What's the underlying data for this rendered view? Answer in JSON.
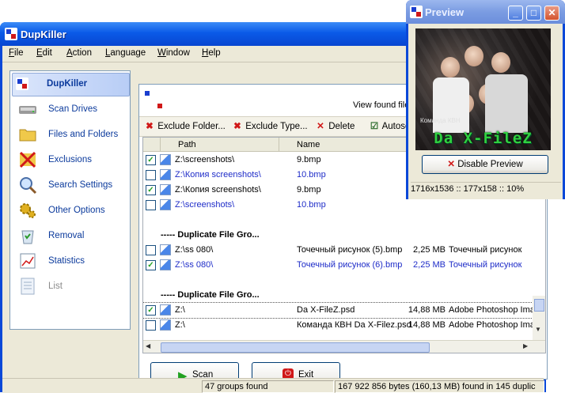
{
  "main_window": {
    "title": "DupKiller",
    "menu": [
      "File",
      "Edit",
      "Action",
      "Language",
      "Window",
      "Help"
    ]
  },
  "sidebar": {
    "header": "DupKiller",
    "items": [
      {
        "label": "Scan Drives",
        "icon": "drive-icon"
      },
      {
        "label": "Files and Folders",
        "icon": "folder-icon"
      },
      {
        "label": "Exclusions",
        "icon": "exclusion-x-icon"
      },
      {
        "label": "Search Settings",
        "icon": "magnifier-icon"
      },
      {
        "label": "Other Options",
        "icon": "gears-icon"
      },
      {
        "label": "Removal",
        "icon": "recycle-bin-icon"
      },
      {
        "label": "Statistics",
        "icon": "chart-icon"
      },
      {
        "label": "List",
        "icon": "list-icon"
      }
    ]
  },
  "main": {
    "view_found_label": "View found files:",
    "toolbar": {
      "exclude_folder": "Exclude Folder...",
      "exclude_type": "Exclude Type...",
      "delete": "Delete",
      "autoselect": "Autoselect"
    },
    "columns": [
      "Path",
      "Name",
      "",
      ""
    ],
    "rows": [
      {
        "type": "file",
        "checked": true,
        "path": "Z:\\screenshots\\",
        "name": "9.bmp",
        "size": "",
        "ftype": "",
        "blue": false
      },
      {
        "type": "file",
        "checked": false,
        "path": "Z:\\Копия screenshots\\",
        "name": "10.bmp",
        "size": "",
        "ftype": "",
        "blue": true
      },
      {
        "type": "file",
        "checked": true,
        "path": "Z:\\Копия screenshots\\",
        "name": "9.bmp",
        "size": "",
        "ftype": "",
        "blue": false
      },
      {
        "type": "file",
        "checked": false,
        "path": "Z:\\screenshots\\",
        "name": "10.bmp",
        "size": "",
        "ftype": "",
        "blue": true
      },
      {
        "type": "blank"
      },
      {
        "type": "group",
        "label": "----- Duplicate File Gro..."
      },
      {
        "type": "file",
        "checked": false,
        "path": "Z:\\ss 080\\",
        "name": "Точечный рисунок (5).bmp",
        "size": "2,25 MB",
        "ftype": "Точечный рисунок",
        "blue": false
      },
      {
        "type": "file",
        "checked": true,
        "path": "Z:\\ss 080\\",
        "name": "Точечный рисунок (6).bmp",
        "size": "2,25 MB",
        "ftype": "Точечный рисунок",
        "blue": true
      },
      {
        "type": "blank"
      },
      {
        "type": "group",
        "label": "----- Duplicate File Gro..."
      },
      {
        "type": "file",
        "checked": true,
        "path": "Z:\\",
        "name": "Da X-FileZ.psd",
        "size": "14,88 MB",
        "ftype": "Adobe Photoshop Ima",
        "blue": false,
        "selected": true
      },
      {
        "type": "file",
        "checked": false,
        "path": "Z:\\",
        "name": "Команда КВН Da X-Filez.psd",
        "size": "14,88 MB",
        "ftype": "Adobe Photoshop Ima",
        "blue": false
      }
    ],
    "scan_button": "Scan",
    "exit_button": "Exit"
  },
  "statusbar": {
    "groups": "47 groups found",
    "bytes": "167 922 856 bytes (160,13 MB) found in 145 duplic"
  },
  "preview_window": {
    "title": "Preview",
    "image_caption": "Da X-FileZ",
    "image_small_text": "Команда КВН",
    "disable_button": "Disable Preview",
    "status": "1716x1536 :: 177x158 :: 10%"
  },
  "colors": {
    "titlebar_blue": "#0a5ae8",
    "inactive_titlebar": "#7b9ce2",
    "link_blue": "#1e2cc8",
    "check_green": "#21a121",
    "accent_red": "#d01818"
  }
}
